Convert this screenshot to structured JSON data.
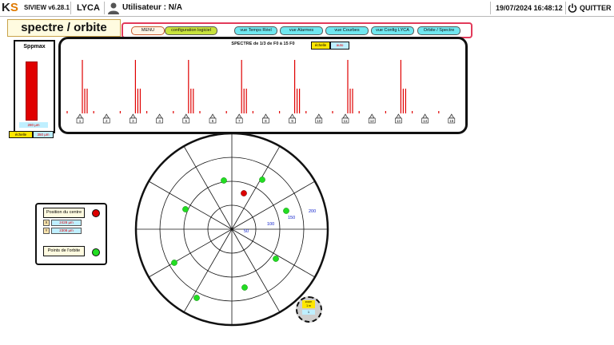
{
  "header": {
    "app_name": "SIVIEW v6.28.1",
    "site": "LYCA",
    "user_label": "Utilisateur : N/A",
    "datetime": "19/07/2024 16:48:12",
    "quit_label": "QUITTER"
  },
  "page_title": "spectre / orbite",
  "nav": {
    "menu": "MENU",
    "config": "configuration logiciel",
    "temps_reel": "vue Temps Réel",
    "alarmes": "vue Alarmes",
    "courbes": "vue Courbes",
    "config_lyca": "vue Config LYCA",
    "orbite": "Orbite / Spectre"
  },
  "spectre": {
    "title": "SPECTRE de 1/3 de F0 à 15 F0",
    "echelle_label": "échelle",
    "echelle_value": "auto",
    "markers": [
      "1",
      "2",
      "3",
      "4",
      "5",
      "6",
      "7",
      "8",
      "9",
      "10",
      "11",
      "12",
      "13",
      "14",
      "15"
    ]
  },
  "spp": {
    "title": "Sppmax",
    "value": "280 µm",
    "level": 0.7,
    "echelle_label": "échelle",
    "echelle_value": "350 µm"
  },
  "legend": {
    "position_label": "Position du centre",
    "x_key": "X",
    "x_value": "2428 µm",
    "y_key": "Y",
    "y_value": "2308 µm",
    "points_label": "Points de l'orbite"
  },
  "polar": {
    "ring_labels": [
      "50",
      "100",
      "150",
      "200"
    ],
    "zoom_label": "zoom",
    "zoom_value": "1 m",
    "zoom_extra": "1"
  },
  "colors": {
    "accent": "#e23a5a",
    "spectrum_line": "#e00000",
    "orbit_point": "#22dd22",
    "center_point": "#dd0000"
  }
}
